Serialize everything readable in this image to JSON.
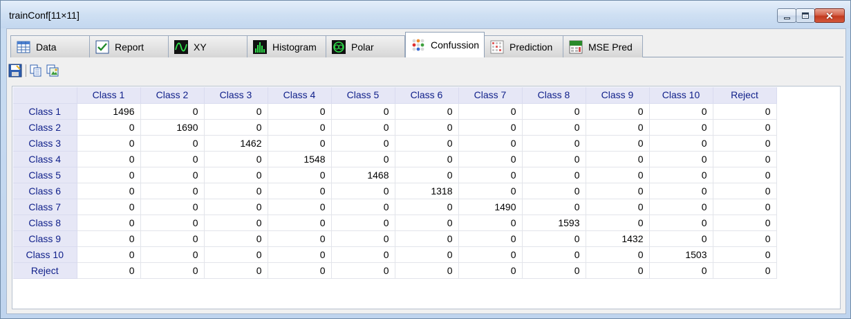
{
  "window": {
    "title": "trainConf[11×11]"
  },
  "tabs": [
    {
      "label": "Data",
      "icon": "data-grid-icon"
    },
    {
      "label": "Report",
      "icon": "report-check-icon"
    },
    {
      "label": "XY",
      "icon": "xy-wave-icon"
    },
    {
      "label": "Histogram",
      "icon": "histogram-icon"
    },
    {
      "label": "Polar",
      "icon": "polar-icon"
    },
    {
      "label": "Confussion",
      "icon": "confusion-dots-icon",
      "active": true
    },
    {
      "label": "Prediction",
      "icon": "prediction-grid-icon"
    },
    {
      "label": "MSE Pred",
      "icon": "mse-pred-icon"
    }
  ],
  "toolbar": {
    "icons": [
      "save-icon",
      "copy-icon",
      "export-image-icon"
    ]
  },
  "grid": {
    "columns": [
      "Class 1",
      "Class 2",
      "Class 3",
      "Class 4",
      "Class 5",
      "Class 6",
      "Class 7",
      "Class 8",
      "Class 9",
      "Class 10",
      "Reject"
    ],
    "rows": [
      {
        "label": "Class 1",
        "values": [
          1496,
          0,
          0,
          0,
          0,
          0,
          0,
          0,
          0,
          0,
          0
        ]
      },
      {
        "label": "Class 2",
        "values": [
          0,
          1690,
          0,
          0,
          0,
          0,
          0,
          0,
          0,
          0,
          0
        ]
      },
      {
        "label": "Class 3",
        "values": [
          0,
          0,
          1462,
          0,
          0,
          0,
          0,
          0,
          0,
          0,
          0
        ]
      },
      {
        "label": "Class 4",
        "values": [
          0,
          0,
          0,
          1548,
          0,
          0,
          0,
          0,
          0,
          0,
          0
        ]
      },
      {
        "label": "Class 5",
        "values": [
          0,
          0,
          0,
          0,
          1468,
          0,
          0,
          0,
          0,
          0,
          0
        ]
      },
      {
        "label": "Class 6",
        "values": [
          0,
          0,
          0,
          0,
          0,
          1318,
          0,
          0,
          0,
          0,
          0
        ]
      },
      {
        "label": "Class 7",
        "values": [
          0,
          0,
          0,
          0,
          0,
          0,
          1490,
          0,
          0,
          0,
          0
        ]
      },
      {
        "label": "Class 8",
        "values": [
          0,
          0,
          0,
          0,
          0,
          0,
          0,
          1593,
          0,
          0,
          0
        ]
      },
      {
        "label": "Class 9",
        "values": [
          0,
          0,
          0,
          0,
          0,
          0,
          0,
          0,
          1432,
          0,
          0
        ]
      },
      {
        "label": "Class 10",
        "values": [
          0,
          0,
          0,
          0,
          0,
          0,
          0,
          0,
          0,
          1503,
          0
        ]
      },
      {
        "label": "Reject",
        "values": [
          0,
          0,
          0,
          0,
          0,
          0,
          0,
          0,
          0,
          0,
          0
        ]
      }
    ]
  },
  "colors": {
    "header_bg": "#e6e7f6",
    "header_text": "#10208a",
    "gridline": "#e2e4ea"
  }
}
